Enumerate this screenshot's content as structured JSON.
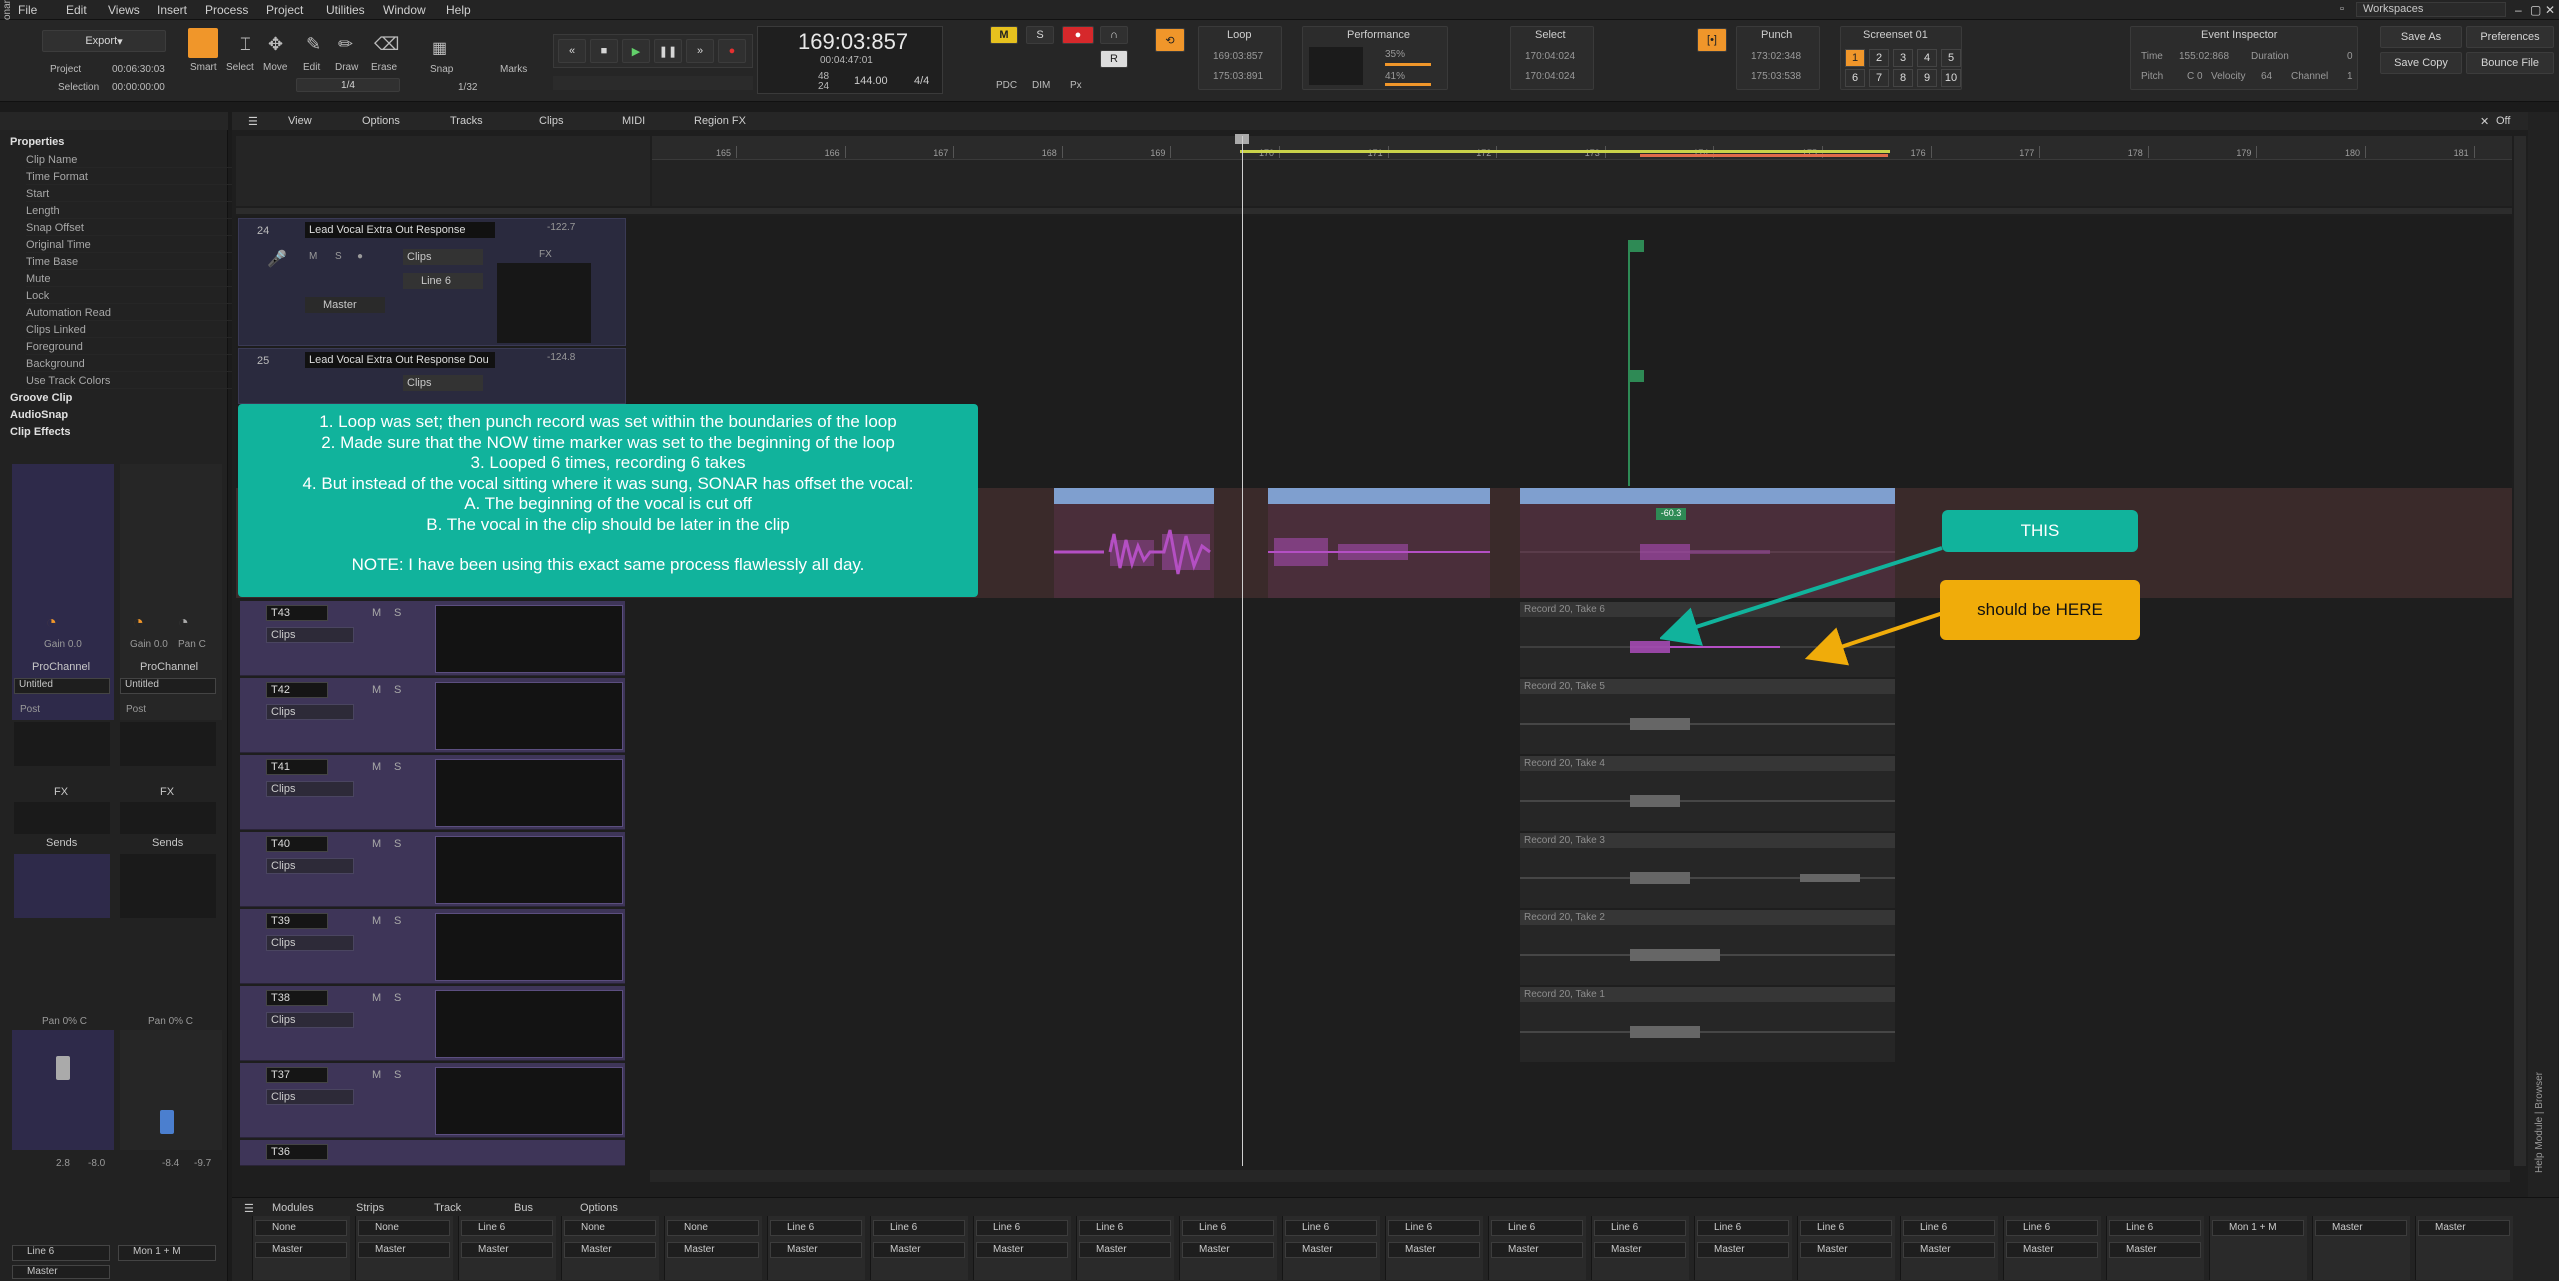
{
  "app": {
    "brand": "Sonar"
  },
  "menu": [
    "File",
    "Edit",
    "Views",
    "Insert",
    "Process",
    "Project",
    "Utilities",
    "Window",
    "Help"
  ],
  "workspaces": "Workspaces",
  "toolbar": {
    "export": "Export",
    "project_label": "Project",
    "project_time": "00:06:30:03",
    "selection_label": "Selection",
    "selection_time": "00:00:00:00",
    "ratio": "1/4",
    "tools": [
      "Smart",
      "Select",
      "Move",
      "Edit",
      "Draw",
      "Erase"
    ],
    "snap": "Snap",
    "snap_value": "1/32",
    "marks": "Marks",
    "time_main": "169:03:857",
    "time_sub": "00:04:47:01",
    "tempo": "144.00",
    "meter": "4/4",
    "rate_top": "48",
    "rate_bottom": "24",
    "loop_label": "Loop",
    "loop_start": "169:03:857",
    "loop_end": "175:03:891",
    "performance_label": "Performance",
    "perf_cpu": "35%",
    "perf_disk": "41%",
    "select_label": "Select",
    "select_start": "170:04:024",
    "select_end": "170:04:024",
    "punch_label": "Punch",
    "punch_start": "173:02:348",
    "punch_end": "175:03:538",
    "screenset_label": "Screenset 01",
    "screensets": [
      "1",
      "2",
      "3",
      "4",
      "5",
      "6",
      "7",
      "8",
      "9",
      "10"
    ],
    "event_inspector": "Event Inspector",
    "ei_time_label": "Time",
    "ei_time": "155:02:868",
    "ei_duration_label": "Duration",
    "ei_duration": "0",
    "ei_pitch_label": "Pitch",
    "ei_pitch": "C 0",
    "ei_velocity_label": "Velocity",
    "ei_velocity": "64",
    "ei_channel_label": "Channel",
    "ei_channel": "1",
    "save_as": "Save As",
    "preferences": "Preferences",
    "save_copy": "Save Copy",
    "bounce_file": "Bounce File",
    "pdc": "PDC",
    "dim": "DIM",
    "px": "Px"
  },
  "inspector": {
    "properties": "Properties",
    "props": [
      "Clip Name",
      "Time Format",
      "Start",
      "Length",
      "Snap Offset",
      "Original Time",
      "Time Base",
      "Mute",
      "Lock",
      "Automation Read",
      "Clips Linked",
      "Foreground",
      "Background",
      "Use Track Colors"
    ],
    "groove_clip": "Groove Clip",
    "audiosnap": "AudioSnap",
    "clip_effects": "Clip Effects",
    "gain1": "Gain 0.0",
    "gain2": "Gain 0.0",
    "pan_c": "Pan C",
    "prochannel": "ProChannel",
    "untitled": "Untitled",
    "post": "Post",
    "fx": "FX",
    "sends": "Sends",
    "pan1": "Pan 0% C",
    "pan2": "Pan 0% C",
    "vol1": "2.8",
    "vol1b": "-8.0",
    "vol2": "-8.4",
    "vol2b": "-9.7",
    "out1": "Line 6",
    "out2": "Mon 1 + M",
    "master": "Master"
  },
  "trackview_menu": [
    "View",
    "Options",
    "Tracks",
    "Clips",
    "MIDI",
    "Region FX"
  ],
  "off_label": "Off",
  "ruler": [
    "165",
    "166",
    "167",
    "168",
    "169",
    "170",
    "171",
    "172",
    "173",
    "174",
    "175",
    "176",
    "177",
    "178",
    "179",
    "180",
    "181"
  ],
  "tracks": [
    {
      "num": "24",
      "name": "Lead Vocal Extra Out Response",
      "peak": "-122.7",
      "clips": "Clips",
      "input": "Line 6",
      "output": "Master"
    },
    {
      "num": "25",
      "name": "Lead Vocal Extra Out Response Dou",
      "peak": "-124.8",
      "clips": "Clips"
    }
  ],
  "takelanes": [
    {
      "name": "T43",
      "clips": "Clips"
    },
    {
      "name": "T42",
      "clips": "Clips"
    },
    {
      "name": "T41",
      "clips": "Clips"
    },
    {
      "name": "T40",
      "clips": "Clips"
    },
    {
      "name": "T39",
      "clips": "Clips"
    },
    {
      "name": "T38",
      "clips": "Clips"
    },
    {
      "name": "T37",
      "clips": "Clips"
    },
    {
      "name": "T36",
      "clips": ""
    }
  ],
  "takes": [
    "Record 20, Take 6",
    "Record 20, Take 5",
    "Record 20, Take 4",
    "Record 20, Take 3",
    "Record 20, Take 2",
    "Record 20, Take 1"
  ],
  "clip_peak": "-60.3",
  "annotation": {
    "lines": [
      "1. Loop was set; then punch record was set within the boundaries of the loop",
      "2. Made sure that the NOW time marker was set to the beginning of the loop",
      "3. Looped 6 times, recording 6 takes",
      "4. But instead of the vocal sitting where it was sung, SONAR has offset the vocal:",
      "A. The beginning of the vocal is cut off",
      "B. The vocal in the clip should be later in the clip",
      "",
      "NOTE: I have been using this exact same process flawlessly all day."
    ],
    "this_label": "THIS",
    "here_label": "should be HERE"
  },
  "bottom_menu": [
    "Modules",
    "Strips",
    "Track",
    "Bus",
    "Options"
  ],
  "strips": [
    {
      "input": "None",
      "output": "Master"
    },
    {
      "input": "None",
      "output": "Master"
    },
    {
      "input": "Line 6",
      "output": "Master"
    },
    {
      "input": "None",
      "output": "Master"
    },
    {
      "input": "None",
      "output": "Master"
    },
    {
      "input": "Line 6",
      "output": "Master"
    },
    {
      "input": "Line 6",
      "output": "Master"
    },
    {
      "input": "Line 6",
      "output": "Master"
    },
    {
      "input": "Line 6",
      "output": "Master"
    },
    {
      "input": "Line 6",
      "output": "Master"
    },
    {
      "input": "Line 6",
      "output": "Master"
    },
    {
      "input": "Line 6",
      "output": "Master"
    },
    {
      "input": "Line 6",
      "output": "Master"
    },
    {
      "input": "Line 6",
      "output": "Master"
    },
    {
      "input": "Line 6",
      "output": "Master"
    },
    {
      "input": "Line 6",
      "output": "Master"
    },
    {
      "input": "Line 6",
      "output": "Master"
    },
    {
      "input": "Line 6",
      "output": "Master"
    },
    {
      "input": "Line 6",
      "output": "Master"
    },
    {
      "input": "Mon 1 + M",
      "output": ""
    },
    {
      "input": "Master",
      "output": ""
    },
    {
      "input": "Master",
      "output": ""
    }
  ],
  "side_tabs": "Help Module | Browser",
  "colors": {
    "accent": "#f0962a",
    "annotation": "#11b39c",
    "callout": "#f0ac0a",
    "clip": "#b44fc4",
    "purple_track": "#3e3558"
  }
}
